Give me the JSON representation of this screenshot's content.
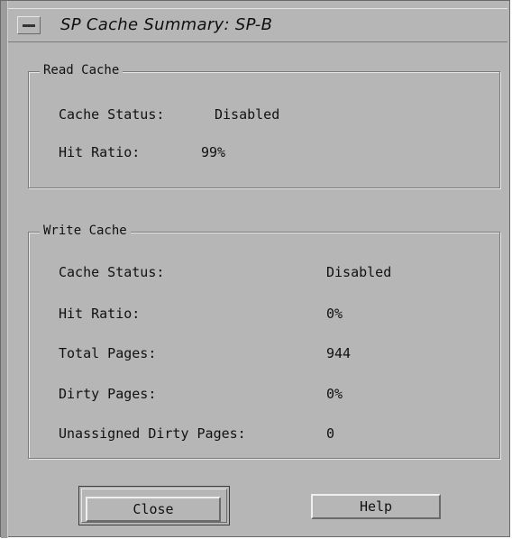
{
  "window": {
    "title": "SP Cache Summary: SP-B"
  },
  "read_cache": {
    "legend": "Read Cache",
    "rows": [
      {
        "label": "Cache Status:",
        "value": "Disabled"
      },
      {
        "label": "Hit Ratio:",
        "value": "99%"
      }
    ]
  },
  "write_cache": {
    "legend": "Write Cache",
    "rows": [
      {
        "label": "Cache Status:",
        "value": "Disabled"
      },
      {
        "label": "Hit Ratio:",
        "value": "0%"
      },
      {
        "label": "Total Pages:",
        "value": "944"
      },
      {
        "label": "Dirty Pages:",
        "value": "0%"
      },
      {
        "label": "Unassigned Dirty Pages:",
        "value": "0"
      }
    ]
  },
  "buttons": {
    "close_label": "Close",
    "help_label": "Help"
  }
}
